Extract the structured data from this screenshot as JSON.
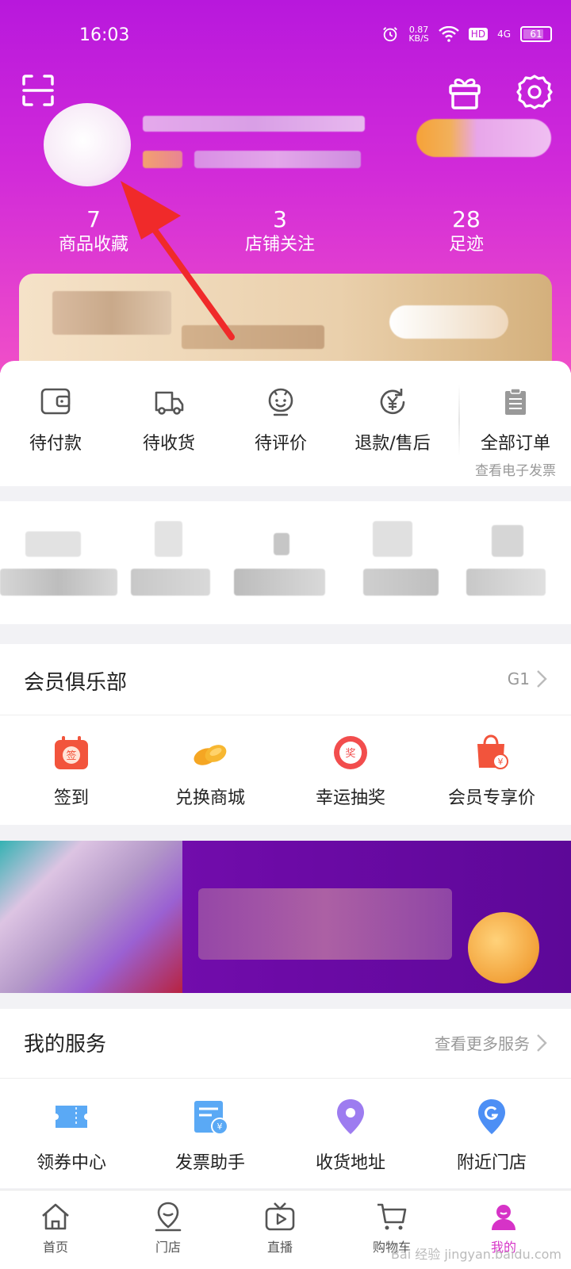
{
  "status_bar": {
    "time": "16:03",
    "net_speed_value": "0.87",
    "net_speed_unit": "KB/S",
    "hd": "HD",
    "signal": "4G",
    "battery": "61"
  },
  "header": {
    "icons": {
      "scan": "scan-icon",
      "gift": "gift-icon",
      "settings": "gear-icon"
    },
    "stats": [
      {
        "value": "7",
        "label": "商品收藏"
      },
      {
        "value": "3",
        "label": "店铺关注"
      },
      {
        "value": "28",
        "label": "足迹"
      }
    ]
  },
  "orders": {
    "items": [
      {
        "label": "待付款",
        "icon": "wallet-icon"
      },
      {
        "label": "待收货",
        "icon": "truck-icon"
      },
      {
        "label": "待评价",
        "icon": "smile-icon"
      },
      {
        "label": "退款/售后",
        "icon": "refund-icon"
      }
    ],
    "all": {
      "label": "全部订单",
      "sub": "查看电子发票",
      "icon": "clipboard-icon"
    }
  },
  "club": {
    "title": "会员俱乐部",
    "level": "G1",
    "items": [
      {
        "label": "签到",
        "icon": "calendar-sign-icon"
      },
      {
        "label": "兑换商城",
        "icon": "coins-icon"
      },
      {
        "label": "幸运抽奖",
        "icon": "lottery-icon"
      },
      {
        "label": "会员专享价",
        "icon": "shopping-bag-icon"
      }
    ]
  },
  "services": {
    "title": "我的服务",
    "more": "查看更多服务",
    "items": [
      {
        "label": "领券中心",
        "icon": "coupon-icon"
      },
      {
        "label": "发票助手",
        "icon": "invoice-icon"
      },
      {
        "label": "收货地址",
        "icon": "location-icon"
      },
      {
        "label": "附近门店",
        "icon": "store-g-icon"
      }
    ]
  },
  "nav": {
    "items": [
      {
        "label": "首页",
        "icon": "home-icon"
      },
      {
        "label": "门店",
        "icon": "store-icon"
      },
      {
        "label": "直播",
        "icon": "live-tv-icon"
      },
      {
        "label": "购物车",
        "icon": "cart-icon"
      },
      {
        "label": "我的",
        "icon": "profile-icon"
      }
    ]
  },
  "colors": {
    "header_start": "#b818dc",
    "header_end": "#f04fc8",
    "accent": "#d633c7",
    "banner": "#6c0aa6"
  },
  "watermark": "Bai 经验 jingyan.baidu.com"
}
